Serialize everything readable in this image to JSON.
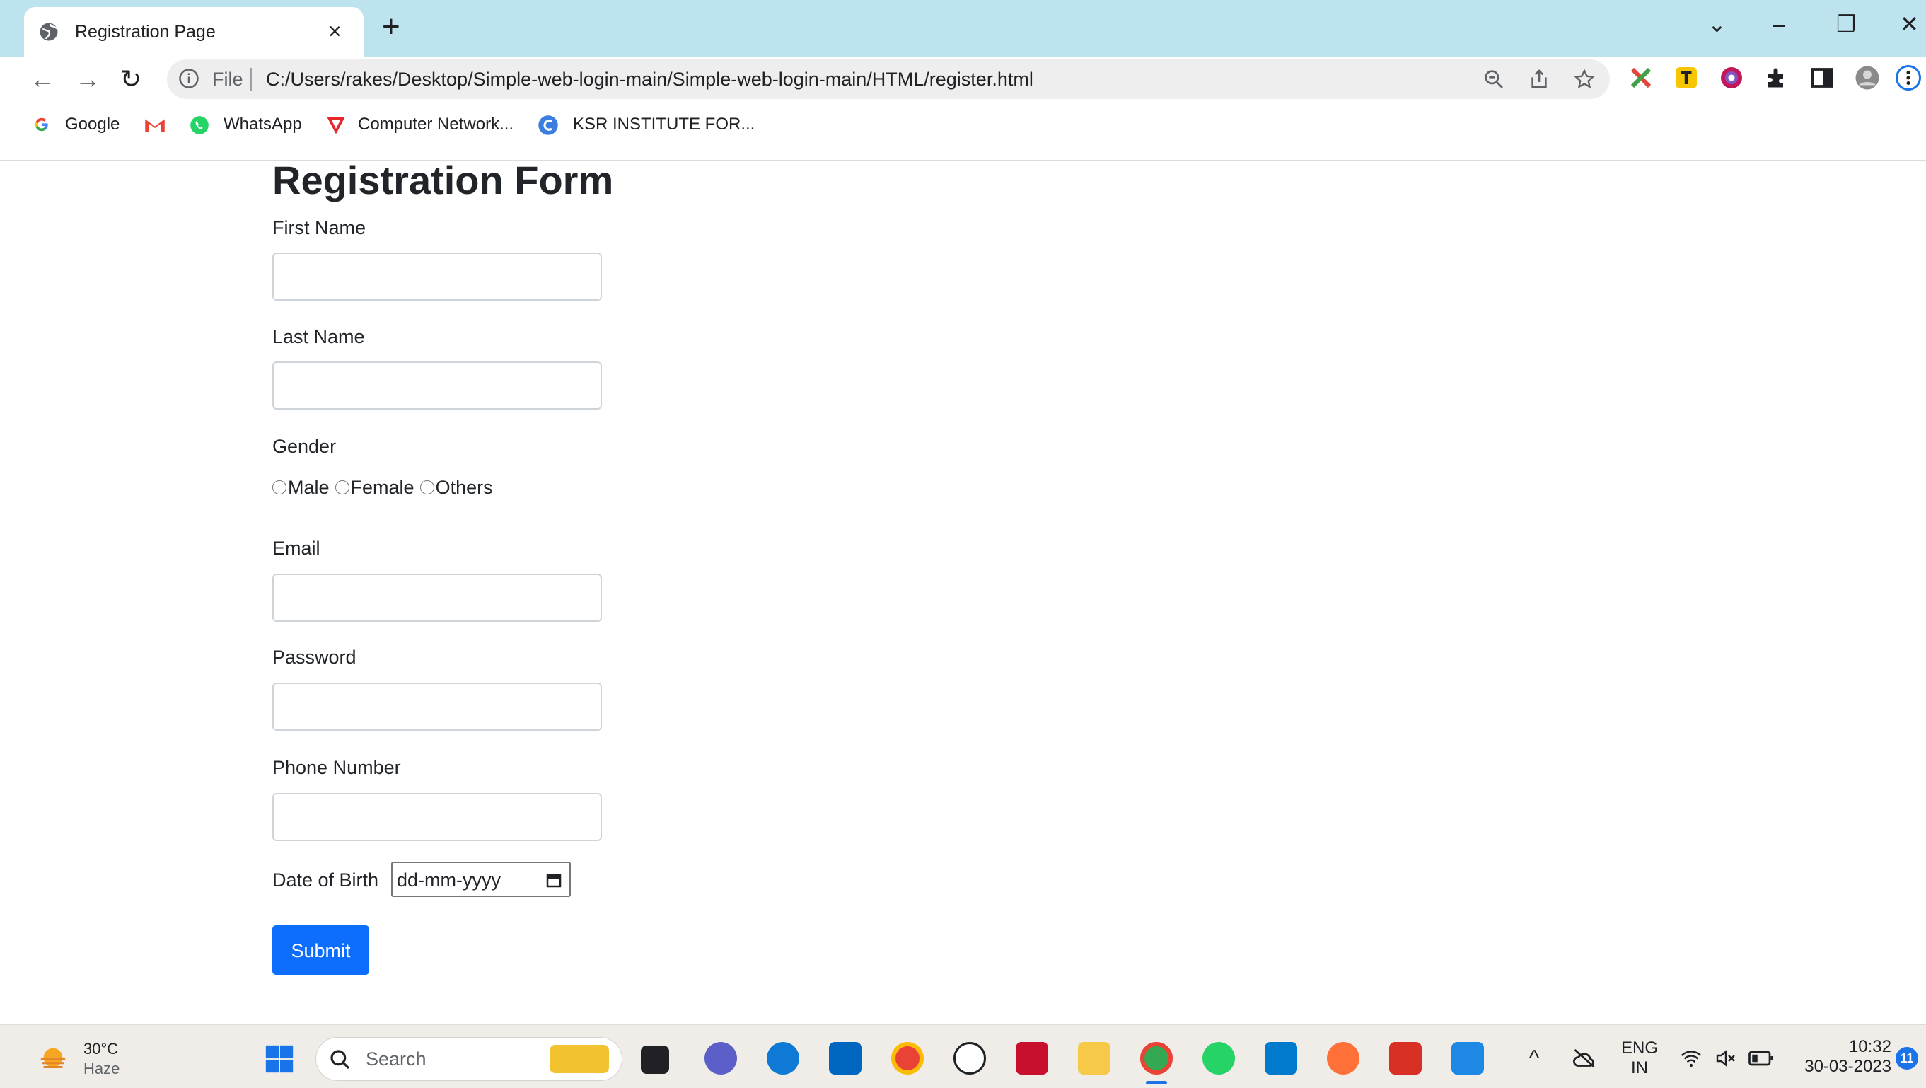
{
  "browser": {
    "tab_title": "Registration Page",
    "tab_close": "×",
    "new_tab": "+",
    "window_controls": {
      "dropdown": "⌄",
      "minimize": "–",
      "restore": "❐",
      "close": "✕"
    },
    "nav": {
      "back": "←",
      "forward": "→",
      "reload": "↻"
    },
    "omnibox": {
      "scheme_label": "File",
      "url": "C:/Users/rakes/Desktop/Simple-web-login-main/Simple-web-login-main/HTML/register.html"
    },
    "bookmarks": [
      {
        "label": "Google",
        "icon": "google-icon",
        "color": "#4285f4"
      },
      {
        "label": "",
        "icon": "gmail-icon",
        "color": "#ea4335"
      },
      {
        "label": "WhatsApp",
        "icon": "whatsapp-icon",
        "color": "#25d366"
      },
      {
        "label": "Computer Network...",
        "icon": "vivaldi-icon",
        "color": "#e8262a"
      },
      {
        "label": "KSR INSTITUTE FOR...",
        "icon": "ksr-icon",
        "color": "#3c7de0"
      }
    ]
  },
  "form": {
    "title": "Registration Form",
    "first_name_label": "First Name",
    "last_name_label": "Last Name",
    "gender_label": "Gender",
    "gender_options": [
      "Male",
      "Female",
      "Others"
    ],
    "email_label": "Email",
    "password_label": "Password",
    "phone_label": "Phone Number",
    "dob_label": "Date of Birth",
    "dob_placeholder": "dd-mm-yyyy",
    "submit_label": "Submit"
  },
  "taskbar": {
    "weather": {
      "temp": "30°C",
      "condition": "Haze"
    },
    "search_label": "Search",
    "tray": {
      "lang_top": "ENG",
      "lang_bottom": "IN",
      "time": "10:32",
      "date": "30-03-2023",
      "notification_count": "11"
    }
  },
  "colors": {
    "tabstrip": "#bde4ee",
    "submit": "#0d6efd",
    "text": "#212529"
  }
}
